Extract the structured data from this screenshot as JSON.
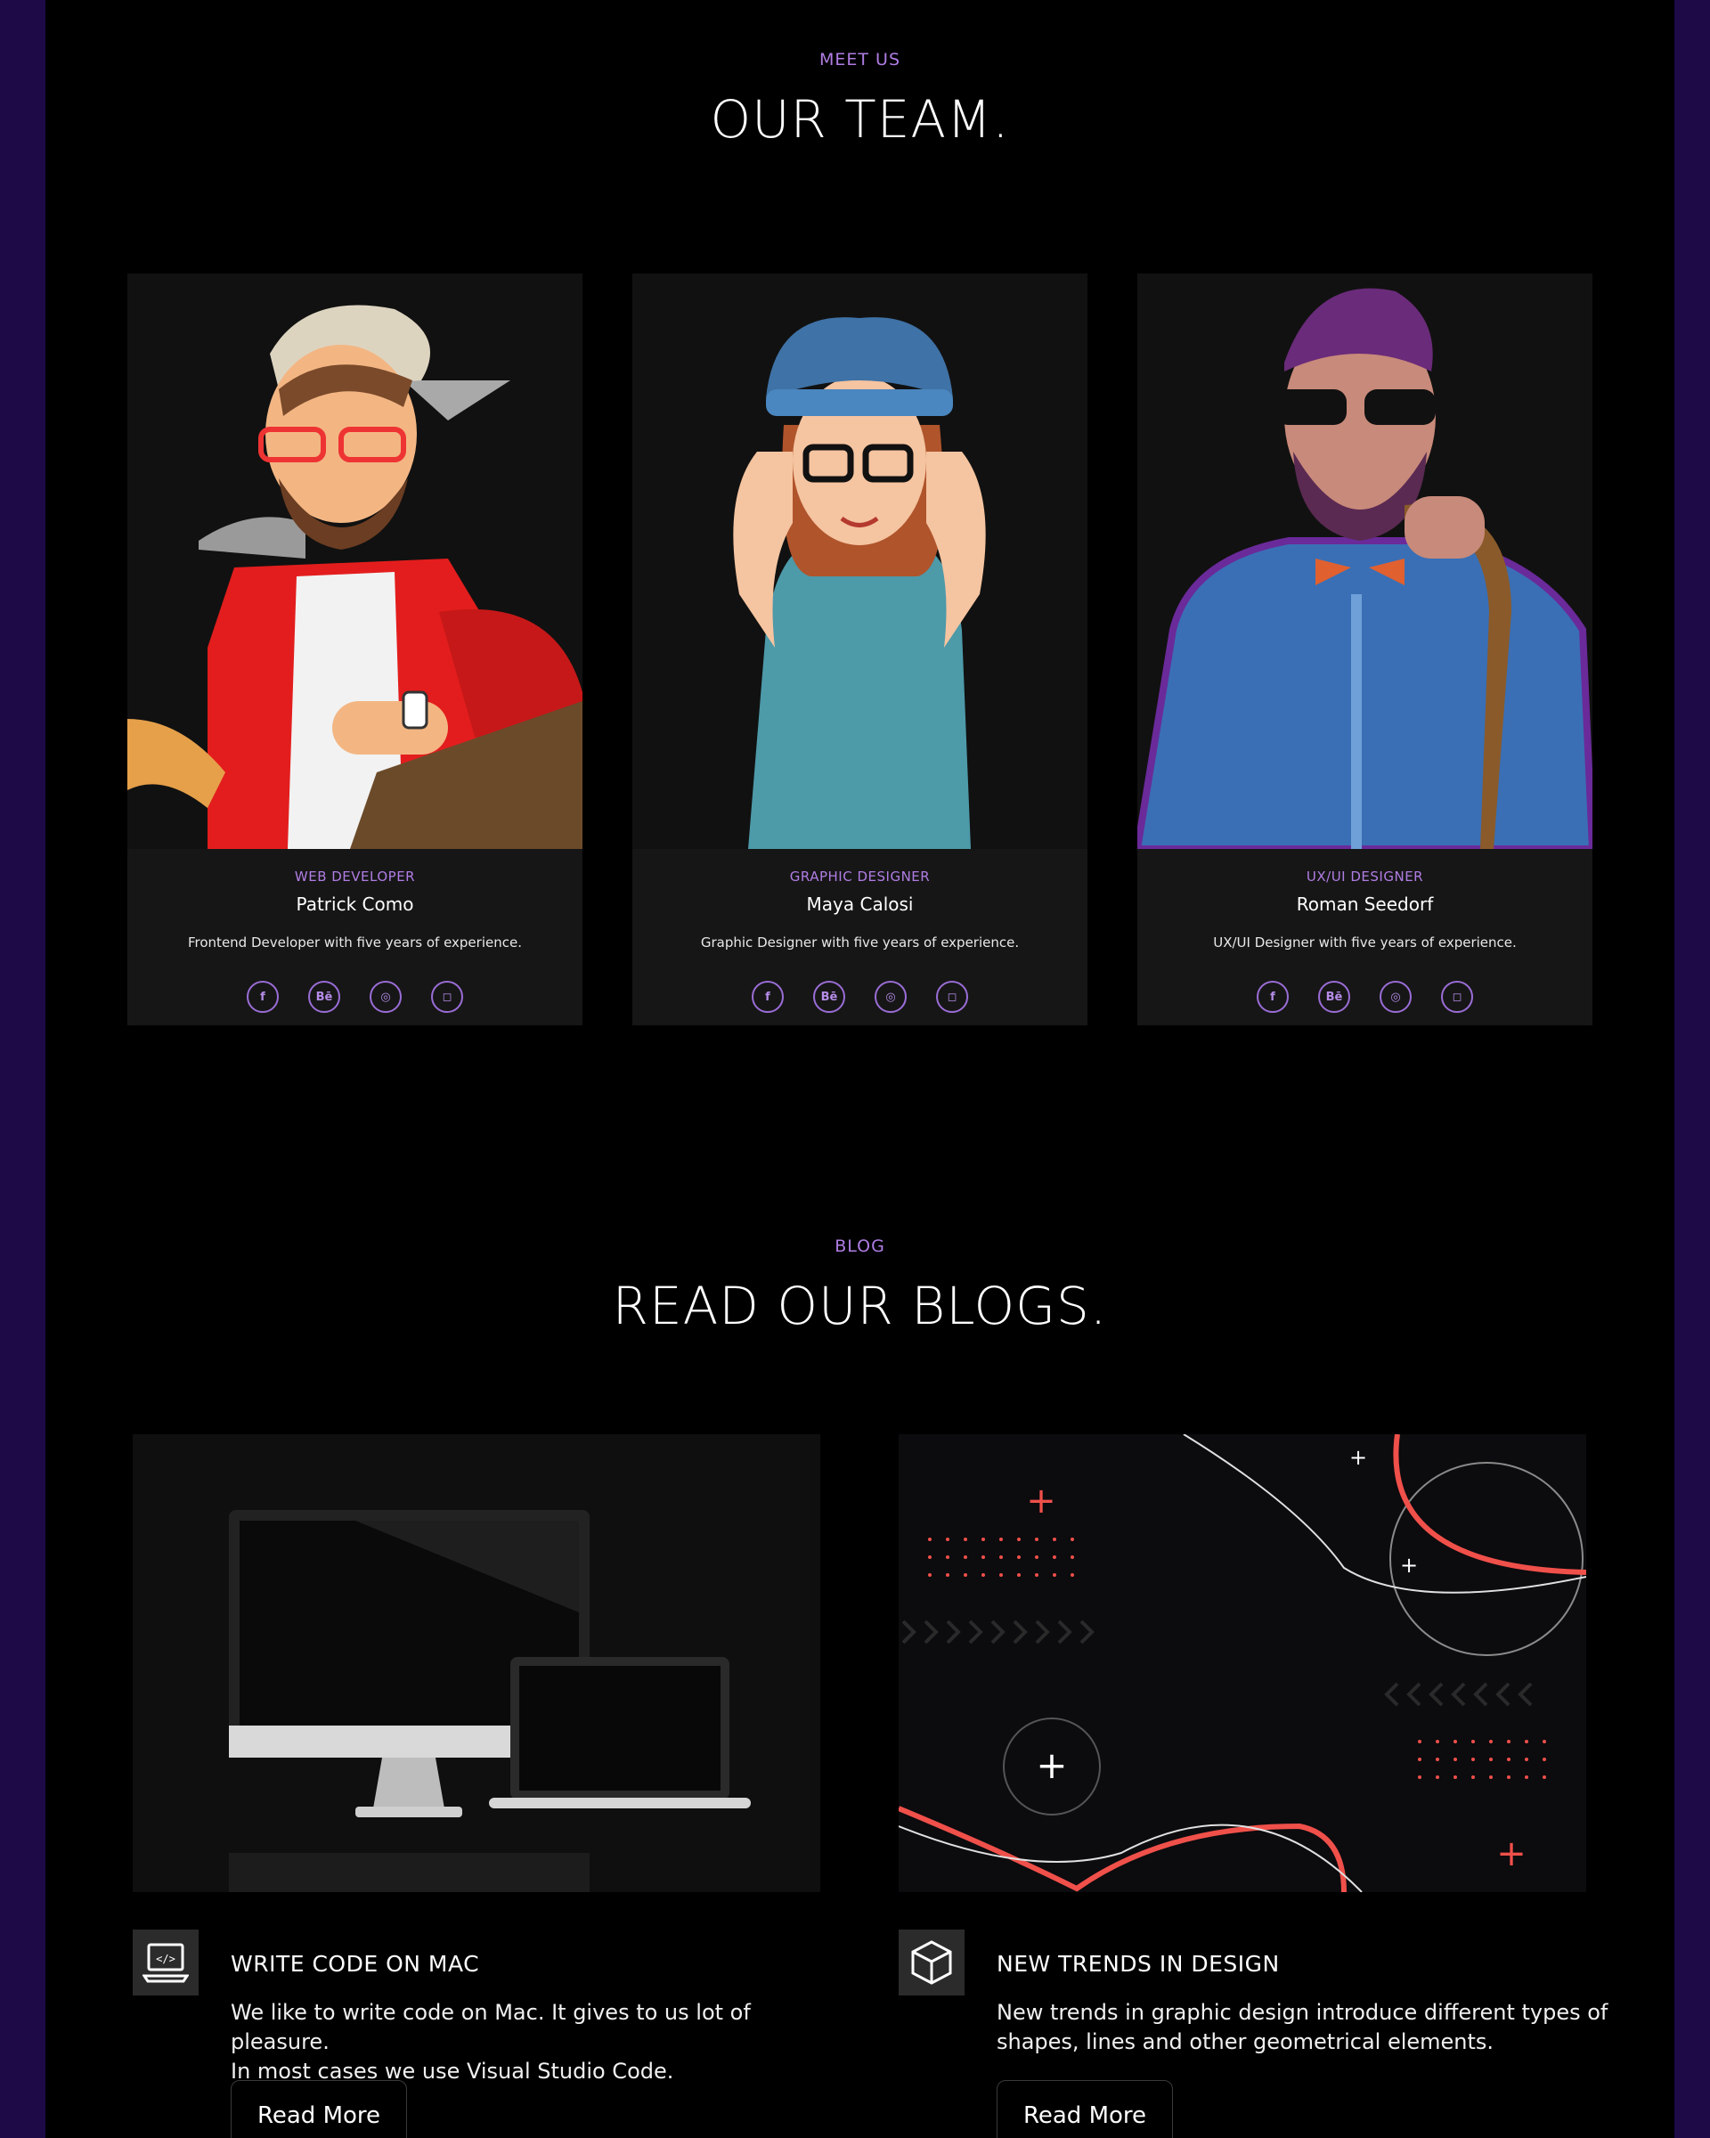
{
  "team_section": {
    "eyebrow": "MEET US",
    "heading": "OUR TEAM.",
    "members": [
      {
        "role": "WEB DEVELOPER",
        "name": "Patrick Como",
        "description": "Frontend Developer with five years of experience."
      },
      {
        "role": "GRAPHIC DESIGNER",
        "name": "Maya Calosi",
        "description": "Graphic Designer with five years of experience."
      },
      {
        "role": "UX/UI DESIGNER",
        "name": "Roman Seedorf",
        "description": "UX/UI Designer with five years of experience."
      }
    ],
    "social_icons": [
      "facebook-icon",
      "behance-icon",
      "dribbble-icon",
      "instagram-icon"
    ],
    "social_glyphs": {
      "facebook": "f",
      "behance": "Bē",
      "dribbble": "◎",
      "instagram": "◻"
    }
  },
  "blog_section": {
    "eyebrow": "BLOG",
    "heading": "READ OUR BLOGS.",
    "posts": [
      {
        "title": "WRITE CODE ON MAC",
        "text_line1": "We like to write code on Mac. It gives to us lot of pleasure.",
        "text_line2": "In most cases we use Visual Studio Code.",
        "button": "Read More",
        "icon": "code-laptop-icon"
      },
      {
        "title": "NEW TRENDS IN DESIGN",
        "text_line1": "New trends in graphic design introduce different types of",
        "text_line2": "shapes, lines and other geometrical elements.",
        "button": "Read More",
        "icon": "cube-icon"
      }
    ],
    "code_icon_text": "</>"
  },
  "colors": {
    "accent": "#b07de4",
    "sidebar": "#1d0a47",
    "background": "#000000",
    "card": "#161616",
    "coral": "#f0504a"
  }
}
